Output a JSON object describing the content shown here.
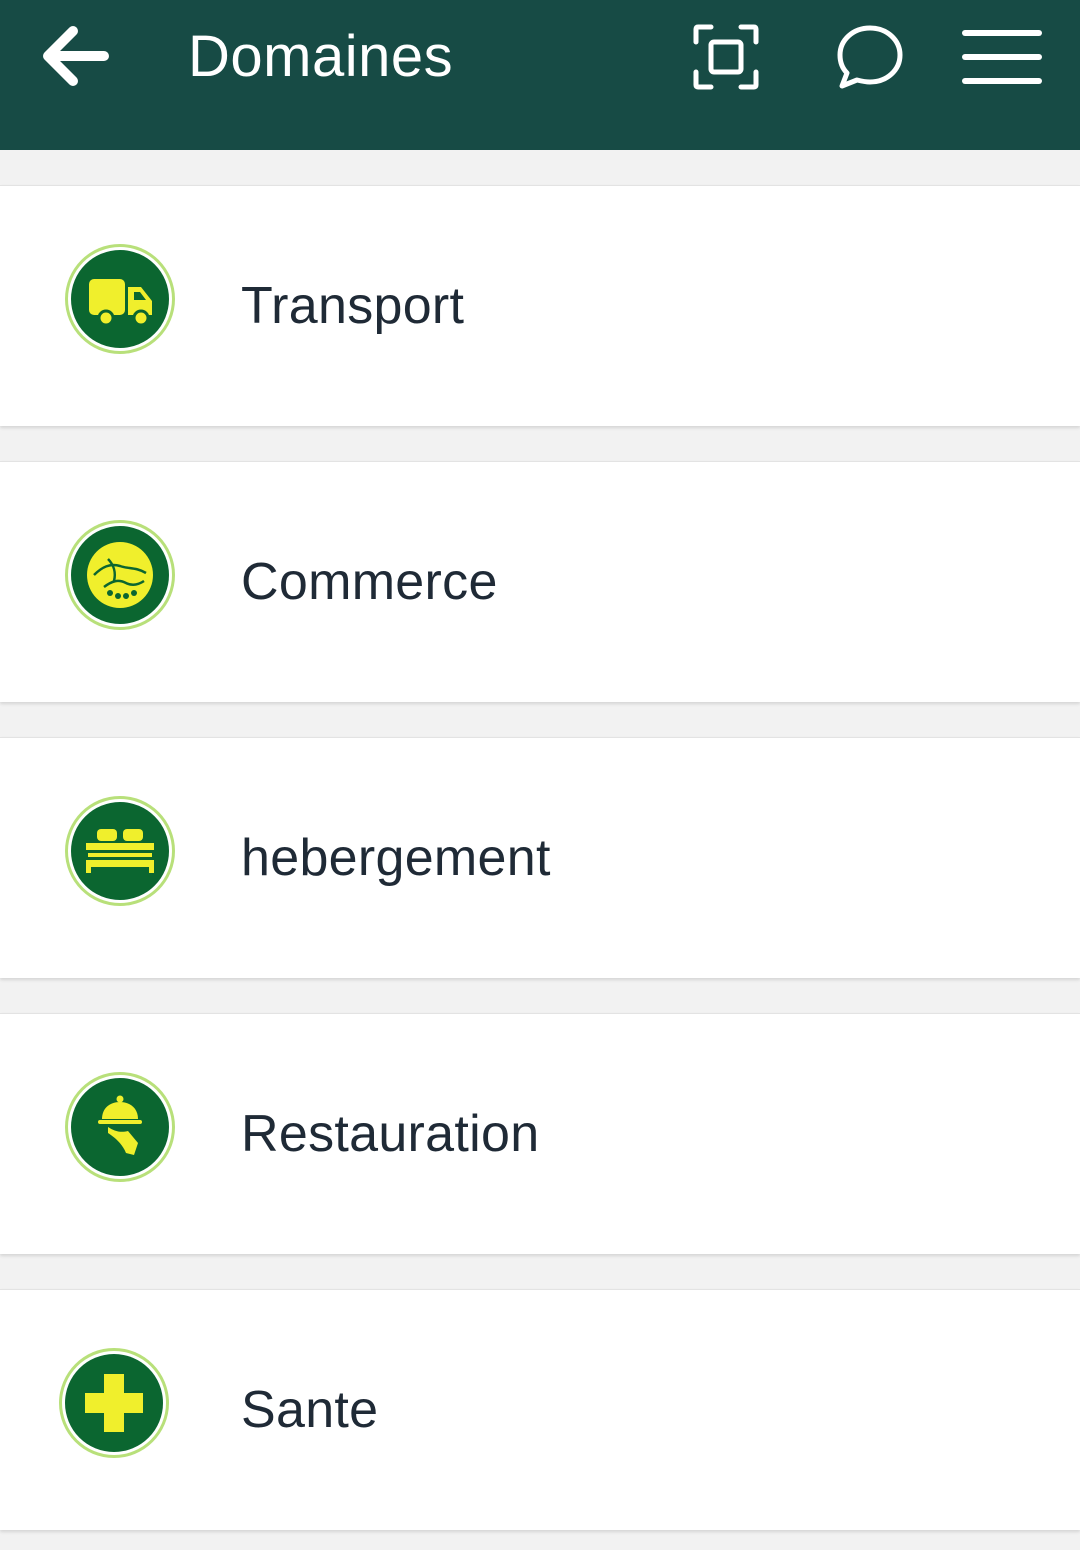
{
  "app_bar": {
    "title": "Domaines",
    "back_icon": "arrow-left-icon",
    "actions": [
      {
        "icon": "scan-frame-icon"
      },
      {
        "icon": "chat-bubble-icon"
      },
      {
        "icon": "hamburger-menu-icon"
      }
    ],
    "background": "#174b45"
  },
  "domains": [
    {
      "label": "Transport",
      "icon": "truck-icon"
    },
    {
      "label": "Commerce",
      "icon": "handshake-icon"
    },
    {
      "label": "hebergement",
      "icon": "bed-icon"
    },
    {
      "label": "Restauration",
      "icon": "serving-cloche-icon"
    },
    {
      "label": "Sante",
      "icon": "medical-cross-icon"
    }
  ],
  "colors": {
    "badge_fill": "#0b6630",
    "badge_symbol": "#f0ef2c",
    "badge_ring": "#b8e07a",
    "text": "#1f2a36",
    "page_background": "#f2f2f2"
  }
}
